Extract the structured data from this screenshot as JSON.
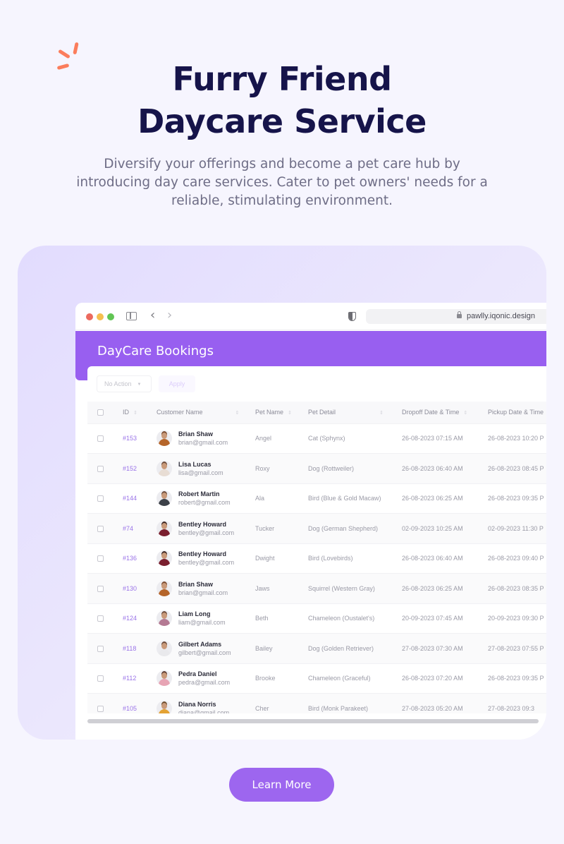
{
  "hero": {
    "title_line1": "Furry Friend",
    "title_line2": "Daycare Service",
    "subtitle": "Diversify your offerings and become a pet care hub by introducing day care services. Cater to pet owners' needs for a reliable, stimulating environment."
  },
  "browser": {
    "url": "pawlly.iqonic.design",
    "icons": [
      "close-dot",
      "minimize-dot",
      "maximize-dot",
      "sidebar-icon",
      "back-icon",
      "forward-icon",
      "shield-icon",
      "lock-icon"
    ],
    "back_glyph": "‹",
    "forward_glyph": "›"
  },
  "app": {
    "page_title": "DayCare Bookings",
    "bulk_action": {
      "selected": "No Action",
      "caret": "▼"
    },
    "apply_label": "Apply",
    "sort_glyph": "⇕",
    "columns": [
      "ID",
      "Customer Name",
      "Pet Name",
      "Pet Detail",
      "Dropoff Date & Time",
      "Pickup Date & Time"
    ],
    "rows": [
      {
        "id": "#153",
        "name": "Brian Shaw",
        "email": "brian@gmail.com",
        "pet": "Angel",
        "detail": "Cat (Sphynx)",
        "dropoff": "26-08-2023 07:15 AM",
        "pickup": "26-08-2023 10:20 P"
      },
      {
        "id": "#152",
        "name": "Lisa Lucas",
        "email": "lisa@gmail.com",
        "pet": "Roxy",
        "detail": "Dog (Rottweiler)",
        "dropoff": "26-08-2023 06:40 AM",
        "pickup": "26-08-2023 08:45 P"
      },
      {
        "id": "#144",
        "name": "Robert Martin",
        "email": "robert@gmail.com",
        "pet": "Ala",
        "detail": "Bird (Blue & Gold Macaw)",
        "dropoff": "26-08-2023 06:25 AM",
        "pickup": "26-08-2023 09:35 P"
      },
      {
        "id": "#74",
        "name": "Bentley Howard",
        "email": "bentley@gmail.com",
        "pet": "Tucker",
        "detail": "Dog (German Shepherd)",
        "dropoff": "02-09-2023 10:25 AM",
        "pickup": "02-09-2023 11:30 P"
      },
      {
        "id": "#136",
        "name": "Bentley Howard",
        "email": "bentley@gmail.com",
        "pet": "Dwight",
        "detail": "Bird (Lovebirds)",
        "dropoff": "26-08-2023 06:40 AM",
        "pickup": "26-08-2023 09:40 P"
      },
      {
        "id": "#130",
        "name": "Brian Shaw",
        "email": "brian@gmail.com",
        "pet": "Jaws",
        "detail": "Squirrel (Western Gray)",
        "dropoff": "26-08-2023 06:25 AM",
        "pickup": "26-08-2023 08:35 P"
      },
      {
        "id": "#124",
        "name": "Liam Long",
        "email": "liam@gmail.com",
        "pet": "Beth",
        "detail": "Chameleon (Oustalet's)",
        "dropoff": "20-09-2023 07:45 AM",
        "pickup": "20-09-2023 09:30 P"
      },
      {
        "id": "#118",
        "name": "Gilbert Adams",
        "email": "gilbert@gmail.com",
        "pet": "Bailey",
        "detail": "Dog (Golden Retriever)",
        "dropoff": "27-08-2023 07:30 AM",
        "pickup": "27-08-2023 07:55 P"
      },
      {
        "id": "#112",
        "name": "Pedra Daniel",
        "email": "pedra@gmail.com",
        "pet": "Brooke",
        "detail": "Chameleon (Graceful)",
        "dropoff": "26-08-2023 07:20 AM",
        "pickup": "26-08-2023 09:35 P"
      },
      {
        "id": "#105",
        "name": "Diana Norris",
        "email": "diana@gmail.com",
        "pet": "Cher",
        "detail": "Bird (Monk Parakeet)",
        "dropoff": "27-08-2023 05:20 AM",
        "pickup": "27-08-2023 09:3"
      }
    ]
  },
  "cta": {
    "label": "Learn More"
  },
  "colors": {
    "brand_purple": "#985ff0",
    "cta_purple": "#9d66ef",
    "title_navy": "#16144a",
    "accent_coral": "#fb7d5c",
    "id_link": "#9a73e8"
  }
}
